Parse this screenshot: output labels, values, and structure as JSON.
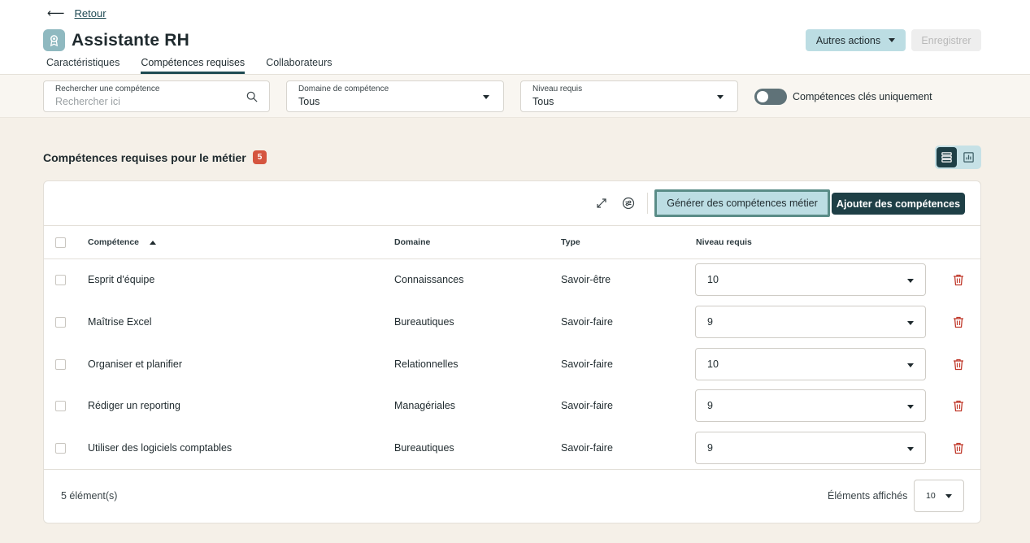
{
  "nav": {
    "back_label": "Retour"
  },
  "header": {
    "title": "Assistante RH",
    "more_actions_label": "Autres actions",
    "save_label": "Enregistrer"
  },
  "tabs": [
    {
      "label": "Caractéristiques",
      "active": false
    },
    {
      "label": "Compétences requises",
      "active": true
    },
    {
      "label": "Collaborateurs",
      "active": false
    }
  ],
  "filters": {
    "search": {
      "label": "Rechercher une compétence",
      "placeholder": "Rechercher ici"
    },
    "domain": {
      "label": "Domaine de compétence",
      "value": "Tous"
    },
    "level": {
      "label": "Niveau requis",
      "value": "Tous"
    },
    "key_only": {
      "label": "Compétences clés uniquement",
      "on": false
    }
  },
  "section": {
    "title": "Compétences requises pour le métier",
    "count_badge": "5"
  },
  "toolbar": {
    "generate_label": "Générer des compétences métier",
    "add_label": "Ajouter des compétences"
  },
  "table": {
    "columns": [
      "Compétence",
      "Domaine",
      "Type",
      "Niveau requis"
    ],
    "rows": [
      {
        "competence": "Esprit d'équipe",
        "domaine": "Connaissances",
        "type": "Savoir-être",
        "niveau": "10"
      },
      {
        "competence": "Maîtrise Excel",
        "domaine": "Bureautiques",
        "type": "Savoir-faire",
        "niveau": "9"
      },
      {
        "competence": "Organiser et planifier",
        "domaine": "Relationnelles",
        "type": "Savoir-faire",
        "niveau": "10"
      },
      {
        "competence": "Rédiger un reporting",
        "domaine": "Managériales",
        "type": "Savoir-faire",
        "niveau": "9"
      },
      {
        "competence": "Utiliser des logiciels comptables",
        "domaine": "Bureautiques",
        "type": "Savoir-faire",
        "niveau": "9"
      }
    ]
  },
  "footer": {
    "count_text": "5 élément(s)",
    "per_page_label": "Éléments affichés",
    "per_page_value": "10"
  },
  "colors": {
    "primary": "#1e3f46",
    "accent_light": "#bcdde3",
    "badge": "#d5553f",
    "delete": "#c0392b",
    "page_bg": "#f5f0e8"
  },
  "icons": {
    "back": "arrow-left-icon",
    "job": "badge-icon",
    "search": "search-icon",
    "expand": "expand-icon",
    "settings": "filter-settings-icon",
    "list_view": "list-view-icon",
    "chart_view": "chart-view-icon",
    "delete": "trash-icon"
  }
}
